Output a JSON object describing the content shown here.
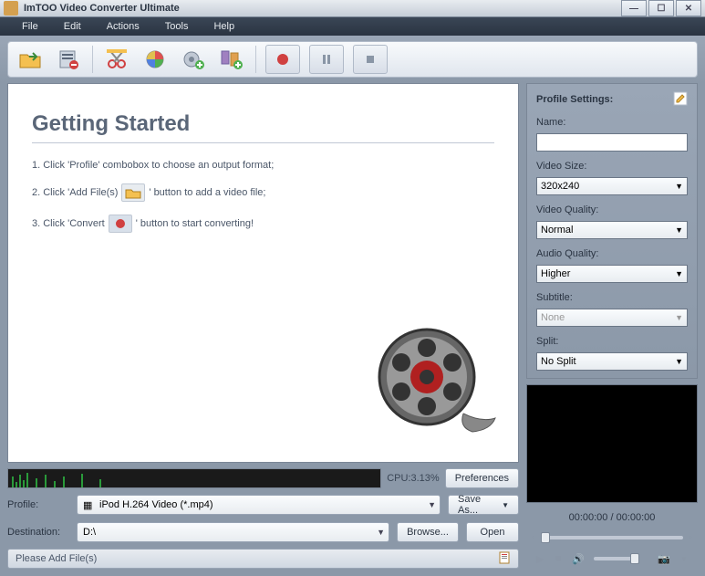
{
  "app": {
    "title": "ImTOO Video Converter Ultimate"
  },
  "menu": {
    "file": "File",
    "edit": "Edit",
    "actions": "Actions",
    "tools": "Tools",
    "help": "Help"
  },
  "main": {
    "heading": "Getting Started",
    "step1a": "1. Click 'Profile' combobox to choose an output format;",
    "step2a": "2. Click 'Add File(s)",
    "step2b": "' button to add a video file;",
    "step3a": "3. Click 'Convert",
    "step3b": "' button to start converting!"
  },
  "cpu": {
    "label": "CPU:3.13%"
  },
  "buttons": {
    "preferences": "Preferences",
    "saveas": "Save As...",
    "browse": "Browse...",
    "open": "Open"
  },
  "profile_row": {
    "label": "Profile:",
    "value": "iPod H.264 Video (*.mp4)"
  },
  "dest_row": {
    "label": "Destination:",
    "value": "D:\\"
  },
  "status": {
    "text": "Please Add File(s)"
  },
  "settings": {
    "title": "Profile Settings:",
    "name_lbl": "Name:",
    "name_val": "",
    "vsize_lbl": "Video Size:",
    "vsize_val": "320x240",
    "vqual_lbl": "Video Quality:",
    "vqual_val": "Normal",
    "aqual_lbl": "Audio Quality:",
    "aqual_val": "Higher",
    "sub_lbl": "Subtitle:",
    "sub_val": "None",
    "split_lbl": "Split:",
    "split_val": "No Split"
  },
  "preview": {
    "time": "00:00:00 / 00:00:00"
  }
}
